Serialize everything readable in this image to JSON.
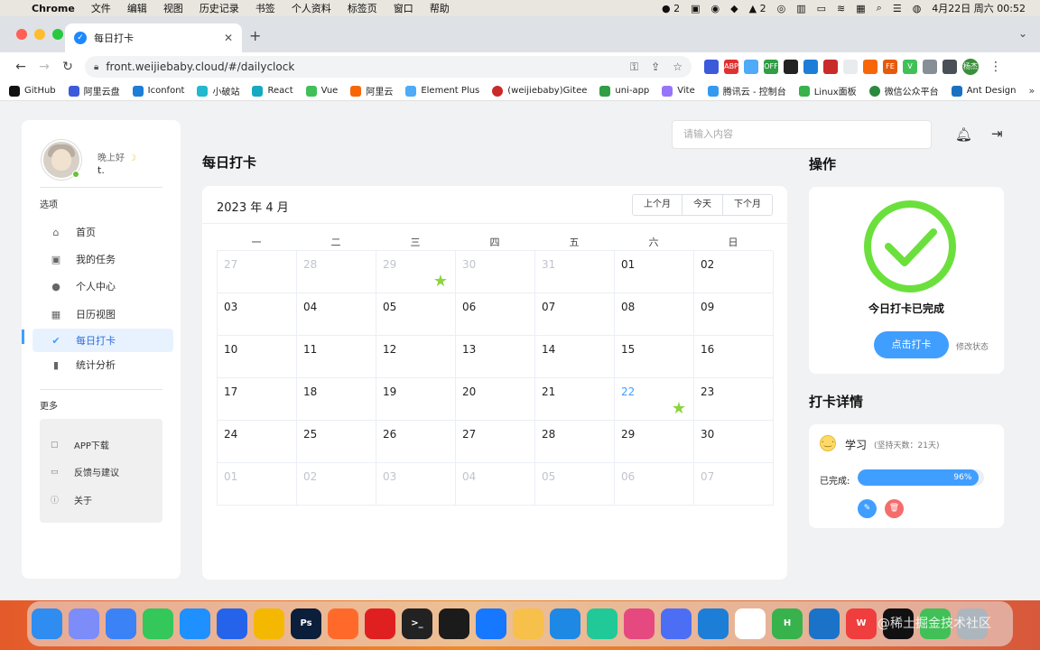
{
  "menubar": {
    "app": "Chrome",
    "items": [
      "文件",
      "编辑",
      "视图",
      "历史记录",
      "书签",
      "个人资料",
      "标签页",
      "窗口",
      "帮助"
    ],
    "right_wechat": "2",
    "right_notif": "2",
    "datetime": "4月22日 周六 00:52"
  },
  "browser": {
    "tab_title": "每日打卡",
    "url": "front.weijiebaby.cloud/#/dailyclock",
    "profile_label": "杨杰",
    "bookmarks": [
      "GitHub",
      "阿里云盘",
      "Iconfont",
      "小破站",
      "React",
      "Vue",
      "阿里云",
      "Element Plus",
      "(weijiebaby)Gitee",
      "uni-app",
      "Vite",
      "腾讯云 - 控制台",
      "Linux面板",
      "微信公众平台",
      "Ant Design"
    ]
  },
  "sidebar": {
    "greeting": "晚上好",
    "username": "t.",
    "options_label": "选项",
    "items": [
      {
        "label": "首页",
        "icon": "home-icon"
      },
      {
        "label": "我的任务",
        "icon": "task-icon"
      },
      {
        "label": "个人中心",
        "icon": "user-icon"
      },
      {
        "label": "日历视图",
        "icon": "calendar-icon"
      },
      {
        "label": "每日打卡",
        "icon": "check-circle-icon"
      },
      {
        "label": "统计分析",
        "icon": "bar-chart-icon"
      }
    ],
    "more_label": "更多",
    "more_items": [
      {
        "label": "APP下载",
        "icon": "download-icon"
      },
      {
        "label": "反馈与建议",
        "icon": "message-icon"
      },
      {
        "label": "关于",
        "icon": "info-icon"
      }
    ]
  },
  "header": {
    "search_placeholder": "请输入内容"
  },
  "main": {
    "title": "每日打卡",
    "calendar": {
      "month_label": "2023 年 4 月",
      "buttons": [
        "上个月",
        "今天",
        "下个月"
      ],
      "weekdays": [
        "一",
        "二",
        "三",
        "四",
        "五",
        "六",
        "日"
      ],
      "days": [
        {
          "d": "27",
          "other": true
        },
        {
          "d": "28",
          "other": true
        },
        {
          "d": "29",
          "other": true,
          "star": true
        },
        {
          "d": "30",
          "other": true
        },
        {
          "d": "31",
          "other": true
        },
        {
          "d": "01"
        },
        {
          "d": "02"
        },
        {
          "d": "03"
        },
        {
          "d": "04"
        },
        {
          "d": "05"
        },
        {
          "d": "06"
        },
        {
          "d": "07"
        },
        {
          "d": "08"
        },
        {
          "d": "09"
        },
        {
          "d": "10"
        },
        {
          "d": "11"
        },
        {
          "d": "12"
        },
        {
          "d": "13"
        },
        {
          "d": "14"
        },
        {
          "d": "15"
        },
        {
          "d": "16"
        },
        {
          "d": "17"
        },
        {
          "d": "18"
        },
        {
          "d": "19"
        },
        {
          "d": "20"
        },
        {
          "d": "21"
        },
        {
          "d": "22",
          "today": true,
          "star": true
        },
        {
          "d": "23"
        },
        {
          "d": "24"
        },
        {
          "d": "25"
        },
        {
          "d": "26"
        },
        {
          "d": "27"
        },
        {
          "d": "28"
        },
        {
          "d": "29"
        },
        {
          "d": "30"
        },
        {
          "d": "01",
          "other": true
        },
        {
          "d": "02",
          "other": true
        },
        {
          "d": "03",
          "other": true
        },
        {
          "d": "04",
          "other": true
        },
        {
          "d": "05",
          "other": true
        },
        {
          "d": "06",
          "other": true
        },
        {
          "d": "07",
          "other": true
        }
      ]
    }
  },
  "operations": {
    "title": "操作",
    "status_text": "今日打卡已完成",
    "punch_button": "点击打卡",
    "modify_link": "修改状态"
  },
  "details": {
    "title": "打卡详情",
    "task_name": "学习",
    "task_days": "(坚持天数：21天)",
    "done_label": "已完成:",
    "progress": 96,
    "progress_text": "96%"
  },
  "colors": {
    "accent": "#409eff",
    "success": "#67c23a",
    "danger": "#f56c6c",
    "check_green": "#6be03d"
  },
  "watermark": "@稀土掘金技术社区"
}
